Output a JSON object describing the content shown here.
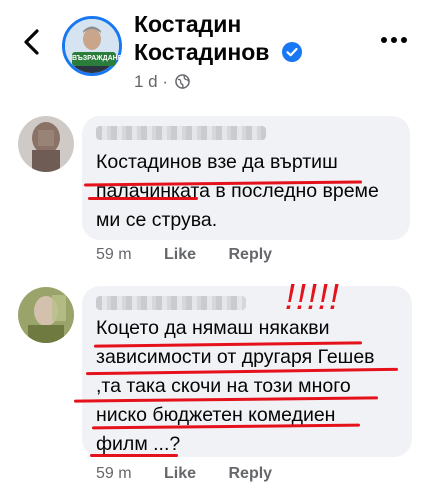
{
  "header": {
    "page_name_line1": "Костадин",
    "page_name_line2": "Костадинов",
    "post_time": "1 d ·",
    "avatar_badge": "ВЪЗРАЖДАНЕ"
  },
  "comments": [
    {
      "lines": [
        "Костадинов взе да въртиш",
        "палачинката в последно време",
        "ми се струва."
      ],
      "time": "59 m",
      "like": "Like",
      "reply": "Reply"
    },
    {
      "lines": [
        "Коцето да нямаш някакви",
        "зависимости от другаря Гешев",
        ",та така скочи на този много",
        "ниско бюджетен комедиен",
        "филм ...?"
      ],
      "time": "59 m",
      "like": "Like",
      "reply": "Reply"
    }
  ],
  "annotation_marks": "!!!!!",
  "colors": {
    "accent": "#1877f2",
    "bubble": "#f0f2f5",
    "secondary_text": "#65676b",
    "annotation_red": "#e5121c"
  }
}
